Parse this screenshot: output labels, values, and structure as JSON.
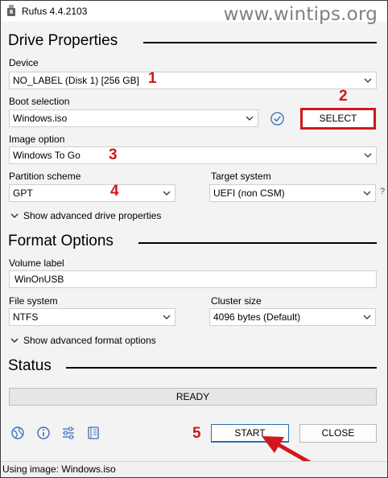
{
  "window": {
    "title": "Rufus 4.4.2103",
    "watermark": "www.wintips.org"
  },
  "drive_properties": {
    "heading": "Drive Properties",
    "device_label": "Device",
    "device_value": "NO_LABEL (Disk 1) [256 GB]",
    "boot_selection_label": "Boot selection",
    "boot_selection_value": "Windows.iso",
    "select_button": "SELECT",
    "image_option_label": "Image option",
    "image_option_value": "Windows To Go",
    "partition_scheme_label": "Partition scheme",
    "partition_scheme_value": "GPT",
    "target_system_label": "Target system",
    "target_system_value": "UEFI (non CSM)",
    "target_help": "?",
    "advanced_toggle": "Show advanced drive properties"
  },
  "format_options": {
    "heading": "Format Options",
    "volume_label_label": "Volume label",
    "volume_label_value": "WinOnUSB",
    "file_system_label": "File system",
    "file_system_value": "NTFS",
    "cluster_size_label": "Cluster size",
    "cluster_size_value": "4096 bytes (Default)",
    "advanced_toggle": "Show advanced format options"
  },
  "status": {
    "heading": "Status",
    "progress_text": "READY",
    "progress_fraction": 0
  },
  "buttons": {
    "start": "START",
    "close": "CLOSE"
  },
  "statusbar": {
    "text": "Using image: Windows.iso"
  },
  "annotations": {
    "n1": "1",
    "n2": "2",
    "n3": "3",
    "n4": "4",
    "n5": "5"
  },
  "colors": {
    "annotation_red": "#d0181c",
    "check_blue": "#3b6fb6"
  },
  "icons": [
    "globe-icon",
    "info-icon",
    "settings-sliders-icon",
    "log-icon",
    "check-icon",
    "chevron-down-icon"
  ]
}
